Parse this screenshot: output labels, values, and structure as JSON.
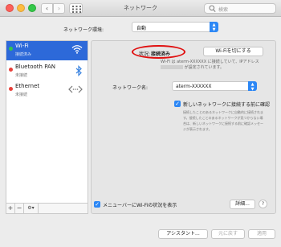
{
  "titlebar": {
    "title": "ネットワーク",
    "search_placeholder": "検索",
    "back_glyph": "‹",
    "forward_glyph": "›"
  },
  "location": {
    "label": "ネットワーク環境:",
    "value": "自動"
  },
  "services": [
    {
      "name": "Wi-Fi",
      "status": "接続済み",
      "dot_color": "#35c84a",
      "icon": "wifi-icon",
      "selected": true
    },
    {
      "name": "Bluetooth PAN",
      "status": "未接続",
      "dot_color": "#e8403a",
      "icon": "bluetooth-icon",
      "selected": false
    },
    {
      "name": "Ethernet",
      "status": "未接続",
      "dot_color": "#e8403a",
      "icon": "ethernet-icon",
      "selected": false
    }
  ],
  "sidebar_toolbar": {
    "add": "+",
    "remove": "−",
    "action": "⚙▾"
  },
  "detail": {
    "status_label": "状況:",
    "status_value": "接続済み",
    "wifi_off_button": "Wi-Fiを切にする",
    "description_line1": "Wi-Fi は aterm-XXXXXX に接続していて、IPアドレス",
    "description_line2": "が設定されています。",
    "network_name_label": "ネットワーク名:",
    "network_name_value": "aterm-XXXXXX",
    "ask_to_join_label": "新しいネットワークに接続する前に確認",
    "ask_to_join_checked": true,
    "ask_to_join_hint": "接続したことのあるネットワークに自動的に接続されます。接続したことのあるネットワークが見つからない場合は、新しいネットワークに接続する前に確認メッセージが表示されます。",
    "show_menubar_label": "メニューバーにWi-Fiの状況を表示",
    "show_menubar_checked": true,
    "details_button": "詳細...",
    "help_button": "?"
  },
  "footer": {
    "assistant_button": "アシスタント...",
    "revert_button": "元に戻す",
    "apply_button": "適用"
  },
  "colors": {
    "accent": "#2c87f5",
    "selection": "#2d69d9",
    "status_oval": "#e01010"
  }
}
